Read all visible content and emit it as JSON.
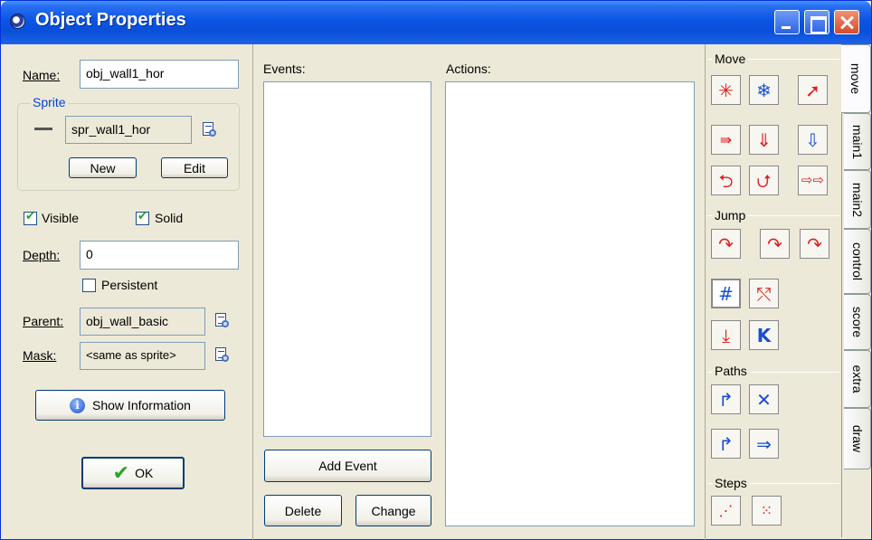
{
  "window": {
    "title": "Object Properties"
  },
  "left": {
    "name_label": "Name:",
    "name_value": "obj_wall1_hor",
    "sprite_group": "Sprite",
    "sprite_value": "spr_wall1_hor",
    "new_label": "New",
    "edit_label": "Edit",
    "visible_label": "Visible",
    "visible_checked": true,
    "solid_label": "Solid",
    "solid_checked": true,
    "depth_label": "Depth:",
    "depth_value": "0",
    "persistent_label": "Persistent",
    "persistent_checked": false,
    "parent_label": "Parent:",
    "parent_value": "obj_wall_basic",
    "mask_label": "Mask:",
    "mask_value": "<same as sprite>",
    "show_info_label": "Show Information",
    "ok_label": "OK"
  },
  "events": {
    "label": "Events:",
    "add_event_label": "Add Event",
    "delete_label": "Delete",
    "change_label": "Change"
  },
  "actions": {
    "label": "Actions:"
  },
  "palette": {
    "sections": [
      "Move",
      "Jump",
      "Paths",
      "Steps"
    ]
  },
  "tabs": [
    "move",
    "main1",
    "main2",
    "control",
    "score",
    "extra",
    "draw"
  ],
  "active_tab": "move",
  "colors": {
    "titlebar": "#0b55e4",
    "window_bg": "#ece9d8",
    "action_red": "#e01f1f",
    "action_blue": "#1a4fd0"
  }
}
